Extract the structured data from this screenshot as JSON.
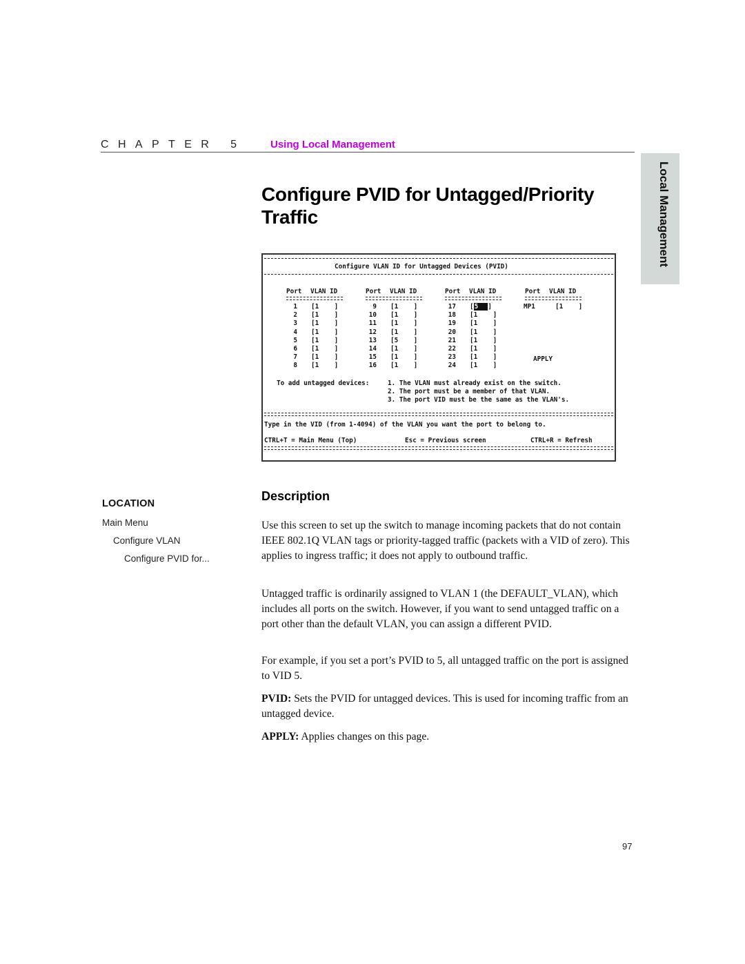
{
  "header": {
    "chapter_label": "CHAPTER 5",
    "chapter_title": "Using Local Management"
  },
  "side_tab": {
    "label": "Local Management"
  },
  "page_title": "Configure PVID for Untagged/Priority Traffic",
  "terminal": {
    "screen_title": "Configure VLAN ID for Untagged Devices (PVID)",
    "column_header_port": "Port",
    "column_header_vlan": "VLAN ID",
    "columns": [
      {
        "ports": [
          {
            "port": "1",
            "vid": "1"
          },
          {
            "port": "2",
            "vid": "1"
          },
          {
            "port": "3",
            "vid": "1"
          },
          {
            "port": "4",
            "vid": "1"
          },
          {
            "port": "5",
            "vid": "1"
          },
          {
            "port": "6",
            "vid": "1"
          },
          {
            "port": "7",
            "vid": "1"
          },
          {
            "port": "8",
            "vid": "1"
          }
        ]
      },
      {
        "ports": [
          {
            "port": "9",
            "vid": "1"
          },
          {
            "port": "10",
            "vid": "1"
          },
          {
            "port": "11",
            "vid": "1"
          },
          {
            "port": "12",
            "vid": "1"
          },
          {
            "port": "13",
            "vid": "5"
          },
          {
            "port": "14",
            "vid": "1"
          },
          {
            "port": "15",
            "vid": "1"
          },
          {
            "port": "16",
            "vid": "1"
          }
        ]
      },
      {
        "ports": [
          {
            "port": "17",
            "vid": "5",
            "selected": true
          },
          {
            "port": "18",
            "vid": "1"
          },
          {
            "port": "19",
            "vid": "1"
          },
          {
            "port": "20",
            "vid": "1"
          },
          {
            "port": "21",
            "vid": "1"
          },
          {
            "port": "22",
            "vid": "1"
          },
          {
            "port": "23",
            "vid": "1"
          },
          {
            "port": "24",
            "vid": "1"
          }
        ]
      },
      {
        "ports": [
          {
            "port": "MP1",
            "vid": "1"
          }
        ]
      }
    ],
    "apply_label": "APPLY",
    "notes_prefix": "To add untagged devices:",
    "notes": [
      "1. The VLAN must already exist on the switch.",
      "2. The port must be a member of that VLAN.",
      "3. The port VID must be the same as the VLAN's."
    ],
    "help_text": "Type in the VID (from 1-4094) of the VLAN you want the port to belong to.",
    "shortcuts": {
      "main_menu": "CTRL+T = Main Menu (Top)",
      "previous": "Esc = Previous screen",
      "refresh": "CTRL+R = Refresh"
    }
  },
  "location": {
    "title": "LOCATION",
    "items": [
      "Main Menu",
      "Configure VLAN",
      "Configure PVID for..."
    ]
  },
  "description": {
    "heading": "Description",
    "paragraphs": [
      "Use this screen to set up the switch to manage incoming packets that do not contain IEEE 802.1Q VLAN tags or priority-tagged traffic (packets with a VID of zero). This applies to ingress traffic; it does not apply to outbound traffic.",
      "Untagged traffic is ordinarily assigned to VLAN 1 (the DEFAULT_VLAN), which includes all ports on the switch. However, if you want to send untagged traffic on a port other than the default VLAN, you can assign a different PVID.",
      "For example, if you set a port’s PVID to 5, all untagged traffic on the port is assigned to VID 5."
    ],
    "fields": [
      {
        "term": "PVID:",
        "text": " Sets the PVID for untagged devices. This is used for incoming traffic from an untagged device."
      },
      {
        "term": "APPLY:",
        "text": " Applies changes on this page."
      }
    ]
  },
  "page_number": "97"
}
